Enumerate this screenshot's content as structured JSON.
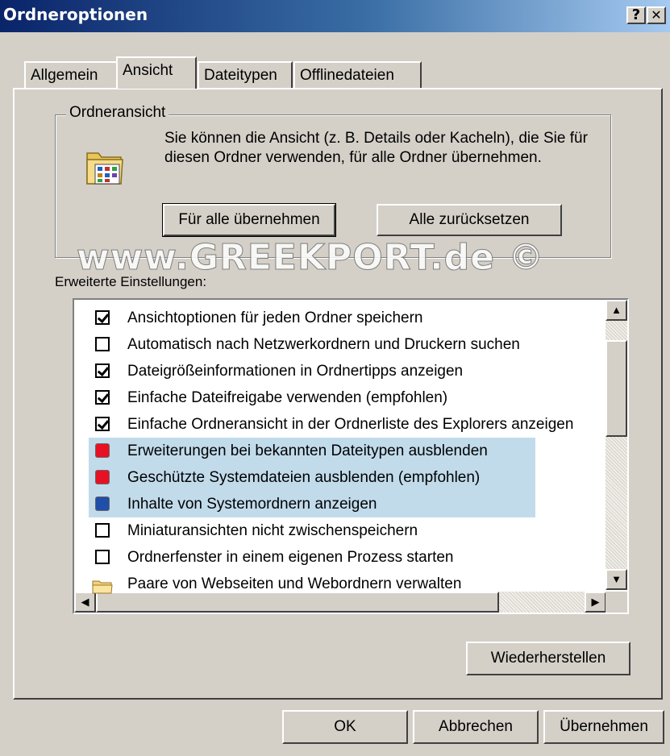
{
  "window": {
    "title": "Ordneroptionen",
    "help_label": "?",
    "close_label": "✕"
  },
  "tabs": [
    {
      "label": "Allgemein"
    },
    {
      "label": "Ansicht"
    },
    {
      "label": "Dateitypen"
    },
    {
      "label": "Offlinedateien"
    }
  ],
  "active_tab": "Ansicht",
  "folder_view": {
    "legend": "Ordneransicht",
    "description": "Sie können die Ansicht (z. B. Details oder Kacheln), die Sie für diesen Ordner verwenden, für alle Ordner übernehmen.",
    "apply_all_label": "Für alle übernehmen",
    "reset_all_label": "Alle zurücksetzen"
  },
  "watermark": "www.GREEKPORT.de ©",
  "advanced": {
    "label": "Erweiterte Einstellungen:",
    "items": [
      {
        "label": "Ansichtoptionen für jeden Ordner speichern",
        "type": "checkbox",
        "checked": true
      },
      {
        "label": "Automatisch nach Netzwerkordnern und Druckern suchen",
        "type": "checkbox",
        "checked": false
      },
      {
        "label": "Dateigrößeinformationen in Ordnertipps anzeigen",
        "type": "checkbox",
        "checked": true
      },
      {
        "label": "Einfache Dateifreigabe verwenden (empfohlen)",
        "type": "checkbox",
        "checked": true
      },
      {
        "label": "Einfache Ordneransicht in der Ordnerliste des Explorers anzeigen",
        "type": "checkbox",
        "checked": true
      },
      {
        "label": "Erweiterungen bei bekannten Dateitypen ausblenden",
        "type": "marker",
        "marker_color": "#e81123",
        "highlighted": true
      },
      {
        "label": "Geschützte Systemdateien ausblenden (empfohlen)",
        "type": "marker",
        "marker_color": "#e81123",
        "highlighted": true
      },
      {
        "label": "Inhalte von Systemordnern anzeigen",
        "type": "marker",
        "marker_color": "#1f4fa8",
        "highlighted": true
      },
      {
        "label": "Miniaturansichten nicht zwischenspeichern",
        "type": "checkbox",
        "checked": false
      },
      {
        "label": "Ordnerfenster in einem eigenen Prozess starten",
        "type": "checkbox",
        "checked": false
      },
      {
        "label": "Paare von Webseiten und Webordnern verwalten",
        "type": "folder"
      }
    ]
  },
  "restore_label": "Wiederherstellen",
  "footer": {
    "ok_label": "OK",
    "cancel_label": "Abbrechen",
    "apply_label": "Übernehmen"
  },
  "colors": {
    "highlight": "#c1dbeb",
    "titlebar_start": "#0a246a",
    "titlebar_end": "#a6caf0"
  }
}
